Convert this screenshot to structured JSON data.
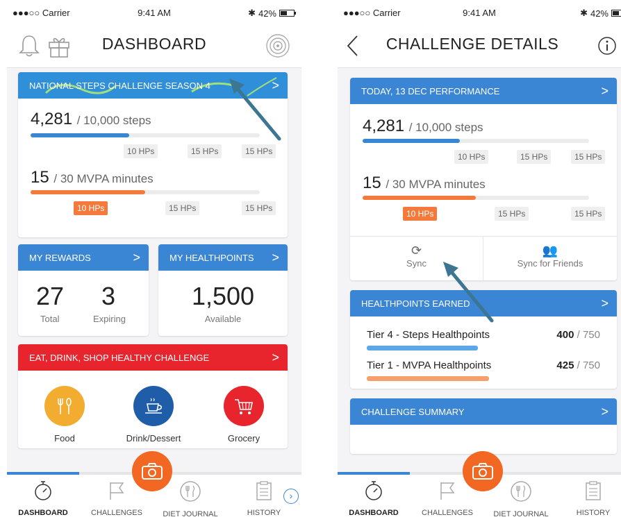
{
  "status": {
    "carrier": "●●●○○ Carrier",
    "time": "9:41 AM",
    "battery": "42%"
  },
  "dashboard": {
    "title": "DASHBOARD",
    "challenge_card": {
      "title": "NATIONAL STEPS CHALLENGE SEASON 4",
      "steps_value": "4,281",
      "steps_goal": "/ 10,000 steps",
      "steps_progress": 0.43,
      "steps_tiers": [
        "10 HPs",
        "15 HPs",
        "15 HPs"
      ],
      "mvpa_value": "15",
      "mvpa_goal": "/ 30 MVPA minutes",
      "mvpa_progress": 0.5,
      "mvpa_tiers": [
        "10 HPs",
        "15 HPs",
        "15 HPs"
      ]
    },
    "rewards": {
      "title": "MY REWARDS",
      "total_value": "27",
      "total_label": "Total",
      "expiring_value": "3",
      "expiring_label": "Expiring"
    },
    "healthpoints": {
      "title": "MY HEALTHPOINTS",
      "value": "1,500",
      "label": "Available"
    },
    "eat_card": {
      "title": "EAT, DRINK, SHOP HEALTHY CHALLENGE",
      "categories": [
        {
          "label": "Food",
          "color": "#f2ac2f"
        },
        {
          "label": "Drink/Dessert",
          "color": "#1f5da8"
        },
        {
          "label": "Grocery",
          "color": "#e8252d"
        }
      ]
    }
  },
  "details": {
    "title": "CHALLENGE DETAILS",
    "performance": {
      "title": "TODAY, 13 DEC PERFORMANCE",
      "steps_value": "4,281",
      "steps_goal": "/ 10,000 steps",
      "steps_progress": 0.43,
      "steps_tiers": [
        "10 HPs",
        "15 HPs",
        "15 HPs"
      ],
      "mvpa_value": "15",
      "mvpa_goal": "/ 30 MVPA minutes",
      "mvpa_progress": 0.5,
      "mvpa_tiers": [
        "10 HPs",
        "15 HPs",
        "15 HPs"
      ],
      "sync_label": "Sync",
      "sync_friends_label": "Sync for Friends"
    },
    "earned": {
      "title": "HEALTHPOINTS EARNED",
      "tiers": [
        {
          "tier": "Tier 4",
          "name": "- Steps Healthpoints",
          "value": "400",
          "max": "/ 750",
          "progress": 0.533,
          "color": "#5aa7ea"
        },
        {
          "tier": "Tier 1",
          "name": "- MVPA Healthpoints",
          "value": "425",
          "max": "/ 750",
          "progress": 0.567,
          "color": "#f5a06a"
        }
      ]
    },
    "summary": {
      "title": "CHALLENGE SUMMARY"
    }
  },
  "tabs": [
    {
      "label": "DASHBOARD",
      "icon": "stopwatch-icon"
    },
    {
      "label": "CHALLENGES",
      "icon": "flag-icon"
    },
    {
      "label": "DIET JOURNAL",
      "icon": "fork-knife-icon"
    },
    {
      "label": "HISTORY",
      "icon": "clipboard-icon"
    }
  ],
  "colors": {
    "accent": "#3a86d4",
    "orange": "#f47a3c",
    "red": "#e8252d",
    "annotation": "#3d7693"
  }
}
